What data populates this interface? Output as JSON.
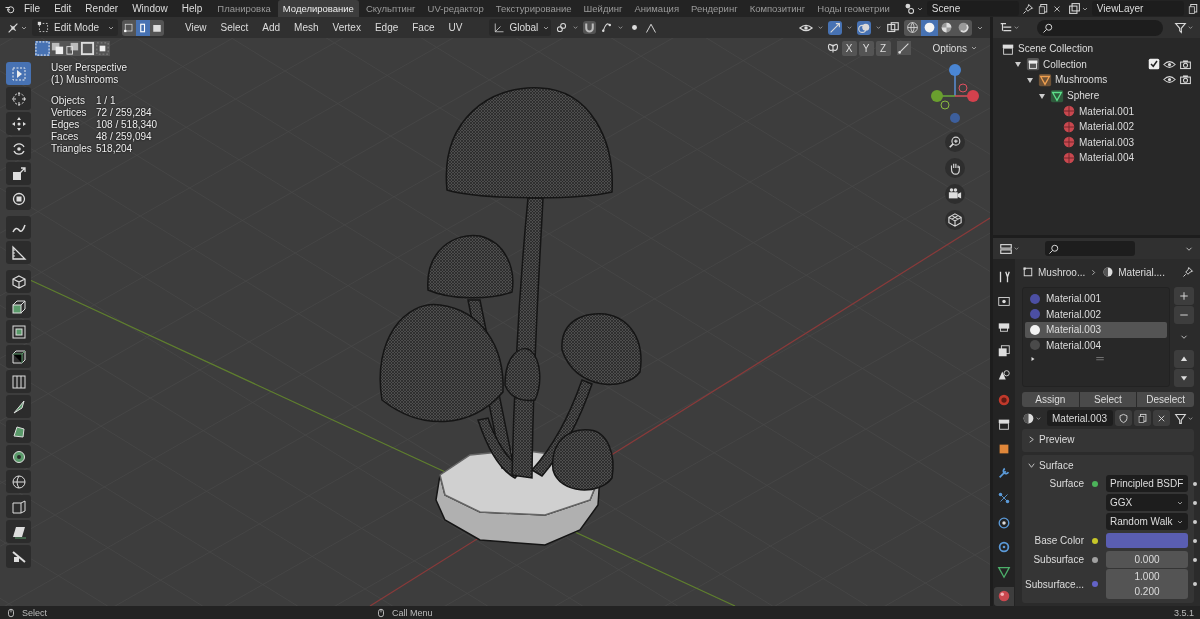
{
  "top_bar": {
    "menus": [
      "File",
      "Edit",
      "Render",
      "Window",
      "Help"
    ],
    "workspaces": [
      {
        "label": "Планировка",
        "selected": false
      },
      {
        "label": "Моделирование",
        "selected": true
      },
      {
        "label": "Скульптинг",
        "selected": false
      },
      {
        "label": "UV-редактор",
        "selected": false
      },
      {
        "label": "Текстурирование",
        "selected": false
      },
      {
        "label": "Шейдинг",
        "selected": false
      },
      {
        "label": "Анимация",
        "selected": false
      },
      {
        "label": "Рендеринг",
        "selected": false
      },
      {
        "label": "Композитинг",
        "selected": false
      },
      {
        "label": "Ноды геометрии",
        "selected": false
      }
    ],
    "scene": "Scene",
    "view_layer": "ViewLayer"
  },
  "viewport": {
    "mode": "Edit Mode",
    "select_modes": [
      {
        "kind": "vertex",
        "selected": false
      },
      {
        "kind": "edge",
        "selected": true
      },
      {
        "kind": "face",
        "selected": false
      }
    ],
    "menus": [
      "View",
      "Select",
      "Add",
      "Mesh",
      "Vertex",
      "Edge",
      "Face",
      "UV"
    ],
    "orientation": "Global",
    "shading": [
      {
        "kind": "wireframe",
        "selected": false
      },
      {
        "kind": "solid",
        "selected": true
      },
      {
        "kind": "material",
        "selected": false
      },
      {
        "kind": "rendered",
        "selected": false
      }
    ],
    "mirror_axes": [
      {
        "label": "X",
        "on": false
      },
      {
        "label": "Y",
        "on": false
      },
      {
        "label": "Z",
        "on": false
      }
    ],
    "options": "Options",
    "view_name": "User Perspective",
    "object_name": "(1) Mushrooms",
    "stats": [
      {
        "label": "Objects",
        "value": "1 / 1"
      },
      {
        "label": "Vertices",
        "value": "72 / 259,284"
      },
      {
        "label": "Edges",
        "value": "108 / 518,340"
      },
      {
        "label": "Faces",
        "value": "48 / 259,094"
      },
      {
        "label": "Triangles",
        "value": "518,204"
      }
    ],
    "tools": [
      {
        "kind": "select",
        "selected": true
      },
      {
        "kind": "cursor",
        "selected": false
      },
      {
        "kind": "move",
        "selected": false
      },
      {
        "kind": "rotate",
        "selected": false
      },
      {
        "kind": "scale",
        "selected": false
      },
      {
        "kind": "transform",
        "selected": false
      },
      {
        "kind": "annotate",
        "selected": false
      },
      {
        "kind": "measure",
        "selected": false
      },
      {
        "kind": "add-cube",
        "selected": false
      },
      {
        "kind": "extrude",
        "selected": false
      },
      {
        "kind": "inset",
        "selected": false
      },
      {
        "kind": "bevel",
        "selected": false
      },
      {
        "kind": "loop-cut",
        "selected": false
      },
      {
        "kind": "knife",
        "selected": false
      },
      {
        "kind": "poly-build",
        "selected": false
      },
      {
        "kind": "spin",
        "selected": false
      },
      {
        "kind": "smooth",
        "selected": false
      },
      {
        "kind": "shrink",
        "selected": false
      },
      {
        "kind": "shear",
        "selected": false
      },
      {
        "kind": "rip",
        "selected": false
      }
    ]
  },
  "outliner": {
    "tree": [
      {
        "label": "Scene Collection",
        "kind": "scene",
        "children": [
          {
            "label": "Collection",
            "kind": "collection",
            "expanded": true,
            "checked": true,
            "visible": true,
            "renderable": true,
            "children": [
              {
                "label": "Mushrooms",
                "kind": "object",
                "expanded": true,
                "visible": true,
                "renderable": true,
                "children": [
                  {
                    "label": "Sphere",
                    "kind": "mesh",
                    "expanded": true,
                    "children": [
                      {
                        "label": "Material.001",
                        "kind": "material"
                      },
                      {
                        "label": "Material.002",
                        "kind": "material"
                      },
                      {
                        "label": "Material.003",
                        "kind": "material"
                      },
                      {
                        "label": "Material.004",
                        "kind": "material"
                      }
                    ]
                  }
                ]
              }
            ]
          }
        ]
      }
    ]
  },
  "properties": {
    "tabs": [
      {
        "kind": "tool",
        "selected": false
      },
      {
        "kind": "render",
        "selected": false
      },
      {
        "kind": "output",
        "selected": false
      },
      {
        "kind": "view-layer",
        "selected": false
      },
      {
        "kind": "scene",
        "selected": false
      },
      {
        "kind": "world",
        "selected": false
      },
      {
        "kind": "collection",
        "selected": false
      },
      {
        "kind": "object",
        "selected": false
      },
      {
        "kind": "modifier",
        "selected": false
      },
      {
        "kind": "particles",
        "selected": false
      },
      {
        "kind": "physics",
        "selected": false
      },
      {
        "kind": "constraints",
        "selected": false
      },
      {
        "kind": "data",
        "selected": false
      },
      {
        "kind": "material",
        "selected": true
      }
    ],
    "breadcrumb": [
      "Mushroo...",
      "Material...."
    ],
    "slots": [
      {
        "name": "Material.001",
        "color": "#4c4fa3",
        "selected": false
      },
      {
        "name": "Material.002",
        "color": "#4c4fa3",
        "selected": false
      },
      {
        "name": "Material.003",
        "color": "#f2f2f2",
        "selected": true
      },
      {
        "name": "Material.004",
        "color": "#4a4a4a",
        "selected": false
      }
    ],
    "slot_buttons": [
      "Assign",
      "Select",
      "Deselect"
    ],
    "material": "Material.003",
    "panels": [
      {
        "title": "Preview",
        "expanded": false
      },
      {
        "title": "Surface",
        "expanded": true,
        "fields": [
          {
            "kind": "shader",
            "label": "Surface",
            "value": "Principled BSDF"
          },
          {
            "kind": "enum",
            "value": "GGX"
          },
          {
            "kind": "enum",
            "value": "Random Walk"
          },
          {
            "kind": "color",
            "label": "Base Color",
            "color": "#5a5eb2"
          },
          {
            "kind": "float",
            "label": "Subsurface",
            "value": "0.000"
          },
          {
            "kind": "vector",
            "label": "Subsurface...",
            "values": [
              "1.000",
              "0.200"
            ]
          }
        ]
      }
    ]
  },
  "status_bar": {
    "hints": [
      "Select",
      "Call Menu"
    ],
    "version": "3.5.1"
  }
}
